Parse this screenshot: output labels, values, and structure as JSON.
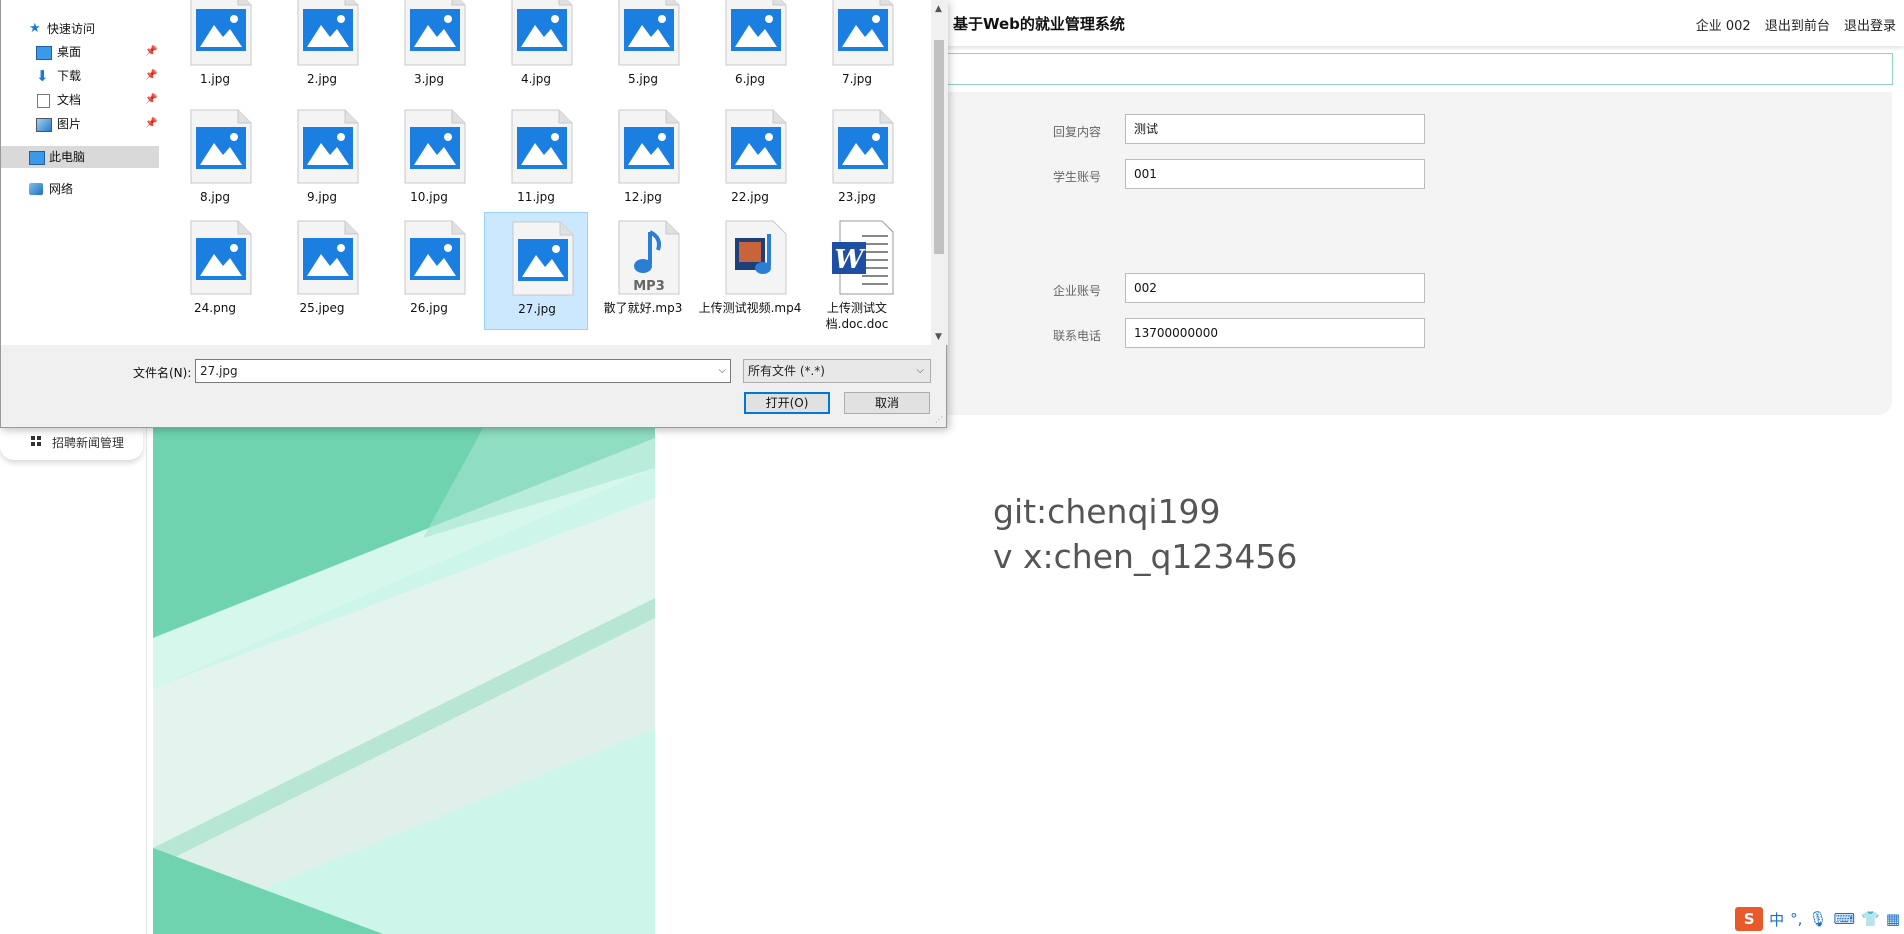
{
  "app": {
    "title": "基于Web的就业管理系统",
    "user_label": "企业 002",
    "back_to_front": "退出到前台",
    "logout": "退出登录"
  },
  "form": {
    "rows": [
      {
        "label": "回复内容",
        "value": "测试"
      },
      {
        "label": "学生账号",
        "value": "001"
      },
      {
        "label": "企业账号",
        "value": "002"
      },
      {
        "label": "联系电话",
        "value": "13700000000"
      }
    ]
  },
  "sidebar": {
    "menu_label": "招聘新闻管理"
  },
  "watermark": {
    "line1": "git:chenqi199",
    "line2": "v x:chen_q123456"
  },
  "dialog": {
    "nav": [
      {
        "label": "快速访问",
        "icon": "star-icon"
      },
      {
        "label": "桌面",
        "icon": "desktop-icon",
        "pinned": true
      },
      {
        "label": "下载",
        "icon": "download-icon",
        "pinned": true
      },
      {
        "label": "文档",
        "icon": "document-icon",
        "pinned": true
      },
      {
        "label": "图片",
        "icon": "picture-icon",
        "pinned": true
      },
      {
        "label": "此电脑",
        "icon": "computer-icon",
        "selected": true
      },
      {
        "label": "网络",
        "icon": "network-icon"
      }
    ],
    "files": [
      {
        "name": "1.jpg",
        "icon": "image-file-icon"
      },
      {
        "name": "2.jpg",
        "icon": "image-file-icon"
      },
      {
        "name": "3.jpg",
        "icon": "image-file-icon"
      },
      {
        "name": "4.jpg",
        "icon": "image-file-icon"
      },
      {
        "name": "5.jpg",
        "icon": "image-file-icon"
      },
      {
        "name": "6.jpg",
        "icon": "image-file-icon"
      },
      {
        "name": "7.jpg",
        "icon": "image-file-icon"
      },
      {
        "name": "8.jpg",
        "icon": "image-file-icon"
      },
      {
        "name": "9.jpg",
        "icon": "image-file-icon"
      },
      {
        "name": "10.jpg",
        "icon": "image-file-icon"
      },
      {
        "name": "11.jpg",
        "icon": "image-file-icon"
      },
      {
        "name": "12.jpg",
        "icon": "image-file-icon"
      },
      {
        "name": "22.jpg",
        "icon": "image-file-icon"
      },
      {
        "name": "23.jpg",
        "icon": "image-file-icon"
      },
      {
        "name": "24.png",
        "icon": "image-file-icon"
      },
      {
        "name": "25.jpeg",
        "icon": "image-file-icon"
      },
      {
        "name": "26.jpg",
        "icon": "image-file-icon"
      },
      {
        "name": "27.jpg",
        "icon": "image-file-icon",
        "selected": true
      },
      {
        "name": "散了就好.mp3",
        "icon": "audio-file-icon"
      },
      {
        "name": "上传测试视频.mp4",
        "icon": "video-file-icon"
      },
      {
        "name": "上传测试文档.doc.doc",
        "icon": "word-file-icon"
      }
    ],
    "filename_label": "文件名(N):",
    "filename_value": "27.jpg",
    "filetype_value": "所有文件 (*.*)",
    "open_label": "打开(O)",
    "cancel_label": "取消"
  },
  "tray": {
    "ime": "中"
  },
  "colors": {
    "accent": "#0078d7",
    "selection": "#cce8ff",
    "teal": "#6fd3b0",
    "image_icon": "#1a7fe0"
  }
}
